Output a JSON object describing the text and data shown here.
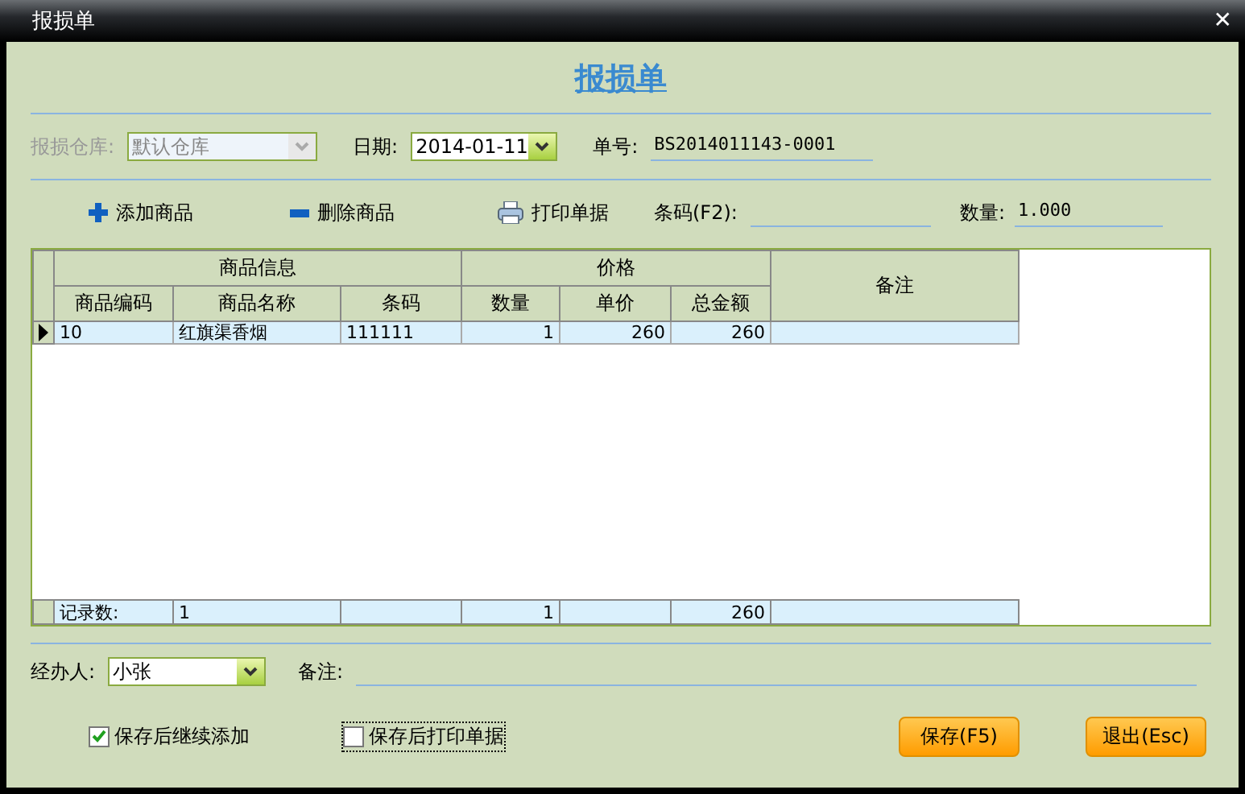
{
  "window": {
    "title": "报损单",
    "close": "✕"
  },
  "heading": "报损单",
  "header_fields": {
    "warehouse": {
      "label": "报损仓库:",
      "value": "默认仓库",
      "disabled": true
    },
    "date": {
      "label": "日期:",
      "value": "2014-01-11"
    },
    "number": {
      "label": "单号:",
      "value": "BS2014011143-0001"
    }
  },
  "toolbar": [
    {
      "kind": "add",
      "label": "添加商品"
    },
    {
      "kind": "delete",
      "label": "删除商品"
    },
    {
      "kind": "print",
      "label": "打印单据"
    }
  ],
  "barcode": {
    "label": "条码(F2):"
  },
  "quantity": {
    "label": "数量:",
    "value": "1.000"
  },
  "table": {
    "groups": [
      "商品信息",
      "价格",
      "备注"
    ],
    "columns": [
      "商品编码",
      "商品名称",
      "条码",
      "数量",
      "单价",
      "总金额"
    ],
    "rows": [
      {
        "selected": true,
        "cells": [
          "10",
          "红旗渠香烟",
          "111111",
          "1",
          "260",
          "260",
          null
        ]
      }
    ],
    "footer": {
      "label": "记录数:",
      "code_count": "1",
      "quantity": "1",
      "total": "260"
    }
  },
  "handler": {
    "label": "经办人:",
    "value": "小张"
  },
  "note": {
    "label": "备注:"
  },
  "options": [
    {
      "label": "保存后继续添加",
      "checked": true,
      "focused": false
    },
    {
      "label": "保存后打印单据",
      "checked": false,
      "focused": true
    }
  ],
  "buttons": [
    "保存(F5)",
    "退出(Esc)"
  ]
}
